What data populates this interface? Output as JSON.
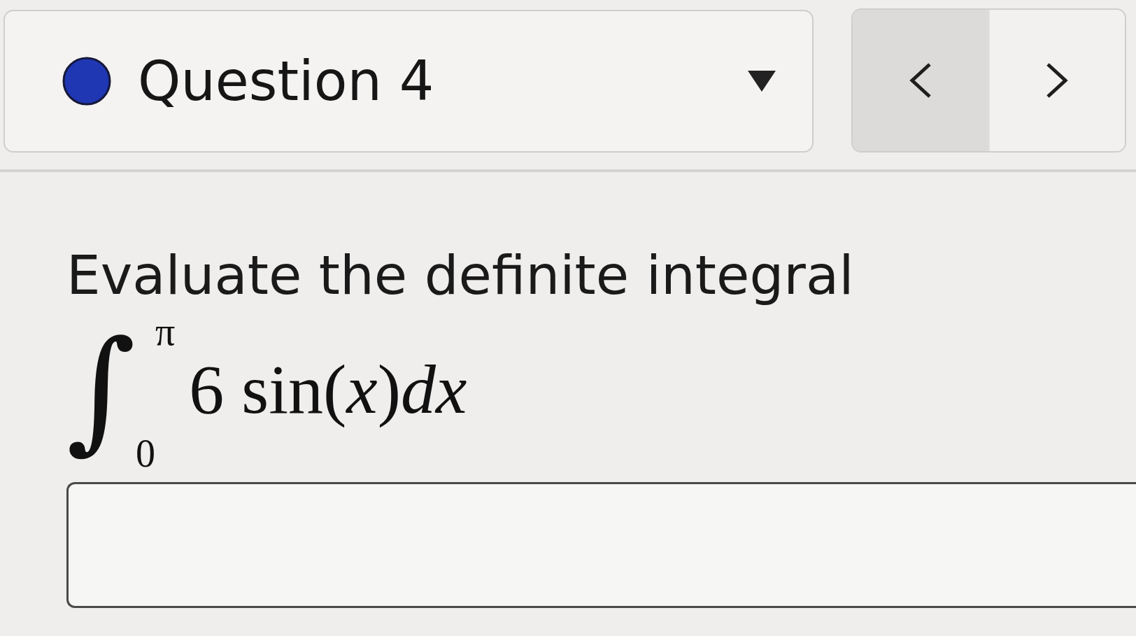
{
  "question_selector": {
    "label": "Question 4"
  },
  "navigation": [
    {
      "kind": "previous",
      "hovered": true
    },
    {
      "kind": "next",
      "hovered": false
    }
  ],
  "question": {
    "prompt": "Evaluate the definite integral",
    "integral": {
      "sign": "∫",
      "upper_limit": "π",
      "lower_limit": "0",
      "integrand": "6 sin(*x*)*dx*"
    }
  }
}
